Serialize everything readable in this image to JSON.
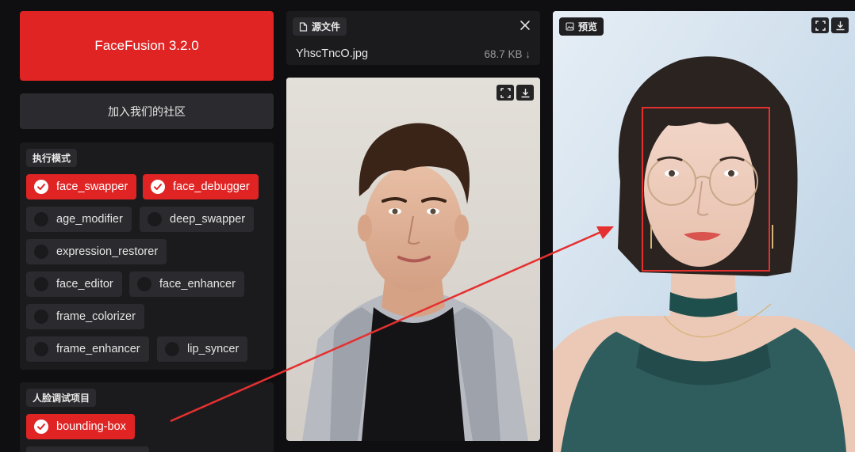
{
  "app": {
    "title": "FaceFusion 3.2.0",
    "community_button": "加入我们的社区"
  },
  "processors": {
    "label": "执行模式",
    "items": [
      {
        "label": "face_swapper",
        "checked": true
      },
      {
        "label": "face_debugger",
        "checked": true
      },
      {
        "label": "age_modifier",
        "checked": false
      },
      {
        "label": "deep_swapper",
        "checked": false
      },
      {
        "label": "expression_restorer",
        "checked": false
      },
      {
        "label": "face_editor",
        "checked": false
      },
      {
        "label": "face_enhancer",
        "checked": false
      },
      {
        "label": "frame_colorizer",
        "checked": false
      },
      {
        "label": "frame_enhancer",
        "checked": false
      },
      {
        "label": "lip_syncer",
        "checked": false
      }
    ]
  },
  "face_debugger": {
    "label": "人脸调试项目",
    "items": [
      {
        "label": "bounding-box",
        "checked": true
      }
    ]
  },
  "source": {
    "label": "源文件",
    "file_name": "YhscTncO.jpg",
    "file_size": "68.7 KB ↓"
  },
  "preview": {
    "label": "预览"
  },
  "colors": {
    "accent": "#e02424",
    "panel": "#1b1b1e",
    "chip": "#2b2b2f",
    "background": "#0f0f11"
  }
}
